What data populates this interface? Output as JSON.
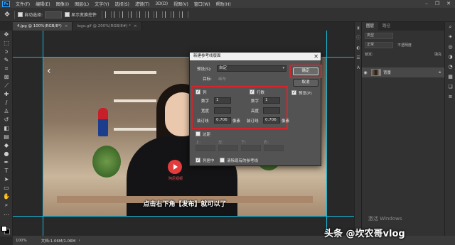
{
  "menu": {
    "logo": "Ps",
    "items": [
      "文件(F)",
      "编辑(E)",
      "图像(I)",
      "图层(L)",
      "文字(Y)",
      "选择(S)",
      "滤镜(T)",
      "3D(D)",
      "视图(V)",
      "窗口(W)",
      "帮助(H)"
    ],
    "window_controls": [
      "–",
      "❐",
      "✕"
    ]
  },
  "options": {
    "auto_select_label": "自动选择:",
    "auto_select_value": "",
    "show_transform_label": "显示变换控件"
  },
  "tabs": [
    {
      "label": "4.jpg @ 100%(RGB/8*)",
      "close": "×",
      "active": true
    },
    {
      "label": "logo.gif @ 200%(RGB/8#) *",
      "close": "×",
      "active": false
    }
  ],
  "document": {
    "subtitle": "点击右下角【发布】就可以了",
    "logo_text": "阿尼视频",
    "nav_arrow": "‹"
  },
  "status": {
    "zoom": "100%",
    "doc_info": "文档:1.06M/1.06M",
    "arrow": "›"
  },
  "panels": {
    "tabs": [
      "图层",
      "路径"
    ],
    "search_label": "类型",
    "mode": "正常",
    "opacity_label": "不透明度",
    "lock_label": "锁定:",
    "fill_label": "填充",
    "layer_name": "背景"
  },
  "dialog": {
    "title": "新建参考线版面",
    "close": "✕",
    "preset_label": "预设(S):",
    "preset_value": "自定",
    "target_label": "目标:",
    "target_value": "画布",
    "ok_label": "确定",
    "cancel_label": "取消",
    "preview_label": "预览(P)",
    "columns": {
      "label": "列",
      "count_label": "数字",
      "count_value": "1",
      "width_label": "宽度",
      "gutter_label": "装订线",
      "gutter_value": "0.706",
      "unit": "像素"
    },
    "rows": {
      "label": "行数",
      "count_label": "数字",
      "count_value": "1",
      "height_label": "高度",
      "gutter_label": "装订线",
      "gutter_value": "0.706",
      "unit": "像素"
    },
    "margin_label": "边距",
    "margin_fields": [
      "上:",
      "左:",
      "下:",
      "右:"
    ],
    "center_columns_label": "列居中",
    "clear_existing_label": "清除现有的参考线"
  },
  "activate_text": "激活 Windows",
  "watermark": "头条 @坎农哥vlog",
  "colors": {
    "guide": "#18b7d6",
    "highlight": "#d8232a",
    "accent": "#31a8ff"
  }
}
